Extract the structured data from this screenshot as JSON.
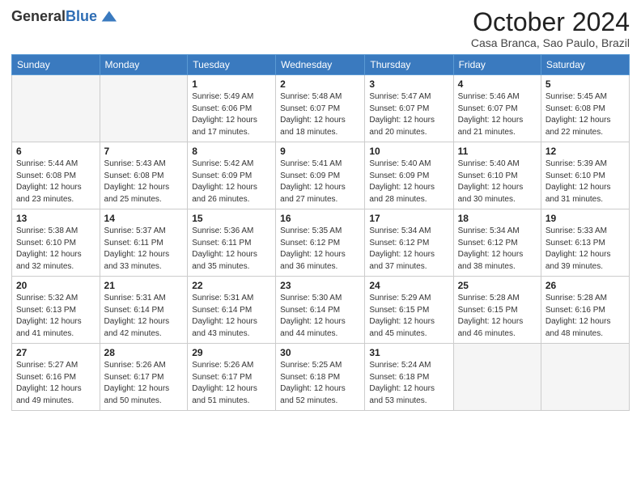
{
  "logo": {
    "general": "General",
    "blue": "Blue"
  },
  "title": {
    "month_year": "October 2024",
    "location": "Casa Branca, Sao Paulo, Brazil"
  },
  "days_of_week": [
    "Sunday",
    "Monday",
    "Tuesday",
    "Wednesday",
    "Thursday",
    "Friday",
    "Saturday"
  ],
  "weeks": [
    [
      {
        "day": "",
        "empty": true
      },
      {
        "day": "",
        "empty": true
      },
      {
        "day": "1",
        "sunrise": "Sunrise: 5:49 AM",
        "sunset": "Sunset: 6:06 PM",
        "daylight": "Daylight: 12 hours and 17 minutes."
      },
      {
        "day": "2",
        "sunrise": "Sunrise: 5:48 AM",
        "sunset": "Sunset: 6:07 PM",
        "daylight": "Daylight: 12 hours and 18 minutes."
      },
      {
        "day": "3",
        "sunrise": "Sunrise: 5:47 AM",
        "sunset": "Sunset: 6:07 PM",
        "daylight": "Daylight: 12 hours and 20 minutes."
      },
      {
        "day": "4",
        "sunrise": "Sunrise: 5:46 AM",
        "sunset": "Sunset: 6:07 PM",
        "daylight": "Daylight: 12 hours and 21 minutes."
      },
      {
        "day": "5",
        "sunrise": "Sunrise: 5:45 AM",
        "sunset": "Sunset: 6:08 PM",
        "daylight": "Daylight: 12 hours and 22 minutes."
      }
    ],
    [
      {
        "day": "6",
        "sunrise": "Sunrise: 5:44 AM",
        "sunset": "Sunset: 6:08 PM",
        "daylight": "Daylight: 12 hours and 23 minutes."
      },
      {
        "day": "7",
        "sunrise": "Sunrise: 5:43 AM",
        "sunset": "Sunset: 6:08 PM",
        "daylight": "Daylight: 12 hours and 25 minutes."
      },
      {
        "day": "8",
        "sunrise": "Sunrise: 5:42 AM",
        "sunset": "Sunset: 6:09 PM",
        "daylight": "Daylight: 12 hours and 26 minutes."
      },
      {
        "day": "9",
        "sunrise": "Sunrise: 5:41 AM",
        "sunset": "Sunset: 6:09 PM",
        "daylight": "Daylight: 12 hours and 27 minutes."
      },
      {
        "day": "10",
        "sunrise": "Sunrise: 5:40 AM",
        "sunset": "Sunset: 6:09 PM",
        "daylight": "Daylight: 12 hours and 28 minutes."
      },
      {
        "day": "11",
        "sunrise": "Sunrise: 5:40 AM",
        "sunset": "Sunset: 6:10 PM",
        "daylight": "Daylight: 12 hours and 30 minutes."
      },
      {
        "day": "12",
        "sunrise": "Sunrise: 5:39 AM",
        "sunset": "Sunset: 6:10 PM",
        "daylight": "Daylight: 12 hours and 31 minutes."
      }
    ],
    [
      {
        "day": "13",
        "sunrise": "Sunrise: 5:38 AM",
        "sunset": "Sunset: 6:10 PM",
        "daylight": "Daylight: 12 hours and 32 minutes."
      },
      {
        "day": "14",
        "sunrise": "Sunrise: 5:37 AM",
        "sunset": "Sunset: 6:11 PM",
        "daylight": "Daylight: 12 hours and 33 minutes."
      },
      {
        "day": "15",
        "sunrise": "Sunrise: 5:36 AM",
        "sunset": "Sunset: 6:11 PM",
        "daylight": "Daylight: 12 hours and 35 minutes."
      },
      {
        "day": "16",
        "sunrise": "Sunrise: 5:35 AM",
        "sunset": "Sunset: 6:12 PM",
        "daylight": "Daylight: 12 hours and 36 minutes."
      },
      {
        "day": "17",
        "sunrise": "Sunrise: 5:34 AM",
        "sunset": "Sunset: 6:12 PM",
        "daylight": "Daylight: 12 hours and 37 minutes."
      },
      {
        "day": "18",
        "sunrise": "Sunrise: 5:34 AM",
        "sunset": "Sunset: 6:12 PM",
        "daylight": "Daylight: 12 hours and 38 minutes."
      },
      {
        "day": "19",
        "sunrise": "Sunrise: 5:33 AM",
        "sunset": "Sunset: 6:13 PM",
        "daylight": "Daylight: 12 hours and 39 minutes."
      }
    ],
    [
      {
        "day": "20",
        "sunrise": "Sunrise: 5:32 AM",
        "sunset": "Sunset: 6:13 PM",
        "daylight": "Daylight: 12 hours and 41 minutes."
      },
      {
        "day": "21",
        "sunrise": "Sunrise: 5:31 AM",
        "sunset": "Sunset: 6:14 PM",
        "daylight": "Daylight: 12 hours and 42 minutes."
      },
      {
        "day": "22",
        "sunrise": "Sunrise: 5:31 AM",
        "sunset": "Sunset: 6:14 PM",
        "daylight": "Daylight: 12 hours and 43 minutes."
      },
      {
        "day": "23",
        "sunrise": "Sunrise: 5:30 AM",
        "sunset": "Sunset: 6:14 PM",
        "daylight": "Daylight: 12 hours and 44 minutes."
      },
      {
        "day": "24",
        "sunrise": "Sunrise: 5:29 AM",
        "sunset": "Sunset: 6:15 PM",
        "daylight": "Daylight: 12 hours and 45 minutes."
      },
      {
        "day": "25",
        "sunrise": "Sunrise: 5:28 AM",
        "sunset": "Sunset: 6:15 PM",
        "daylight": "Daylight: 12 hours and 46 minutes."
      },
      {
        "day": "26",
        "sunrise": "Sunrise: 5:28 AM",
        "sunset": "Sunset: 6:16 PM",
        "daylight": "Daylight: 12 hours and 48 minutes."
      }
    ],
    [
      {
        "day": "27",
        "sunrise": "Sunrise: 5:27 AM",
        "sunset": "Sunset: 6:16 PM",
        "daylight": "Daylight: 12 hours and 49 minutes."
      },
      {
        "day": "28",
        "sunrise": "Sunrise: 5:26 AM",
        "sunset": "Sunset: 6:17 PM",
        "daylight": "Daylight: 12 hours and 50 minutes."
      },
      {
        "day": "29",
        "sunrise": "Sunrise: 5:26 AM",
        "sunset": "Sunset: 6:17 PM",
        "daylight": "Daylight: 12 hours and 51 minutes."
      },
      {
        "day": "30",
        "sunrise": "Sunrise: 5:25 AM",
        "sunset": "Sunset: 6:18 PM",
        "daylight": "Daylight: 12 hours and 52 minutes."
      },
      {
        "day": "31",
        "sunrise": "Sunrise: 5:24 AM",
        "sunset": "Sunset: 6:18 PM",
        "daylight": "Daylight: 12 hours and 53 minutes."
      },
      {
        "day": "",
        "empty": true
      },
      {
        "day": "",
        "empty": true
      }
    ]
  ]
}
